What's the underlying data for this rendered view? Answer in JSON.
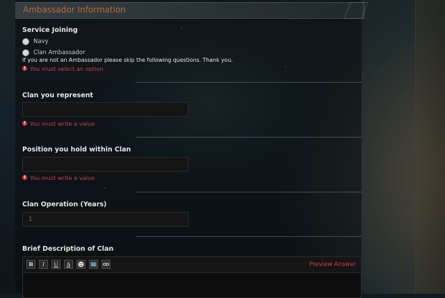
{
  "section_title": "Ambassador Information",
  "service": {
    "label": "Service Joining",
    "options": [
      "Navy",
      "Clan Ambassador"
    ],
    "note": "If you are not an Ambassador please skip the following questions. Thank you.",
    "error": "You must select an option"
  },
  "clan": {
    "label": "Clan you represent",
    "value": "",
    "error": "You must write a value"
  },
  "position": {
    "label": "Position you hold within Clan",
    "value": "",
    "error": "You must write a value"
  },
  "operation": {
    "label": "Clan Operation (Years)",
    "value": "1"
  },
  "description": {
    "label": "Brief Description of Clan",
    "toolbar": [
      "B",
      "I",
      "U",
      "A",
      "smiley-icon",
      "image-icon",
      "link-icon"
    ],
    "preview_label": "Preview Answer"
  },
  "colors": {
    "title": "#b8672e",
    "error": "#d23a3a"
  }
}
